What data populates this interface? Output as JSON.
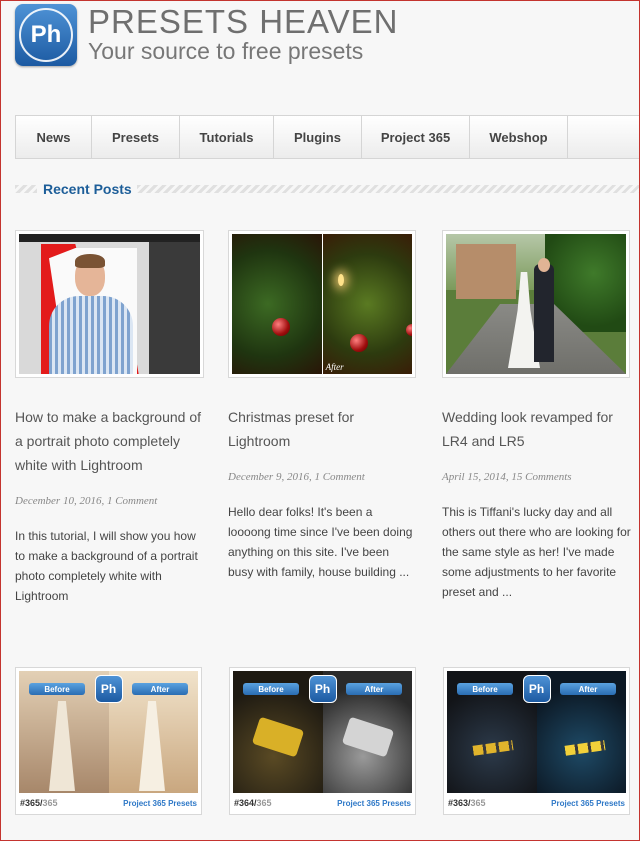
{
  "header": {
    "logo_text": "Ph",
    "title": "PRESETS HEAVEN",
    "tagline": "Your source to free presets"
  },
  "nav": [
    {
      "label": "News"
    },
    {
      "label": "Presets"
    },
    {
      "label": "Tutorials"
    },
    {
      "label": "Plugins"
    },
    {
      "label": "Project 365"
    },
    {
      "label": "Webshop"
    }
  ],
  "recent_posts": {
    "heading": "Recent Posts",
    "posts": [
      {
        "title_lines": [
          "How to make a background of",
          "a portrait photo completely",
          "white with Lightroom"
        ],
        "meta": "December 10, 2016, 1 Comment",
        "excerpt_lines": [
          "In this tutorial, I will show you how",
          "to make a background of a portrait",
          "photo completely white with",
          "Lightroom"
        ]
      },
      {
        "title_lines": [
          "Christmas preset for",
          "Lightroom"
        ],
        "meta": "December 9, 2016, 1 Comment",
        "excerpt_lines": [
          "Hello dear folks! It's been a",
          "loooong time since I've been doing",
          "anything on this site. I've been",
          "busy with family, house building ..."
        ],
        "image_label": "After"
      },
      {
        "title_lines": [
          "Wedding look revamped for",
          "LR4 and LR5"
        ],
        "meta": "April 15, 2014, 15 Comments",
        "excerpt_lines": [
          "This is Tiffani's lucky day and all",
          "others out there who are looking for",
          "the same style as her! I've made",
          "some adjustments to her favorite",
          "preset and ..."
        ]
      }
    ]
  },
  "project365": {
    "before_label": "Before",
    "after_label": "After",
    "badge": "Ph",
    "link_label": "Project 365 Presets",
    "items": [
      {
        "number": "#365/",
        "total": "365"
      },
      {
        "number": "#364/",
        "total": "365"
      },
      {
        "number": "#363/",
        "total": "365"
      }
    ]
  }
}
